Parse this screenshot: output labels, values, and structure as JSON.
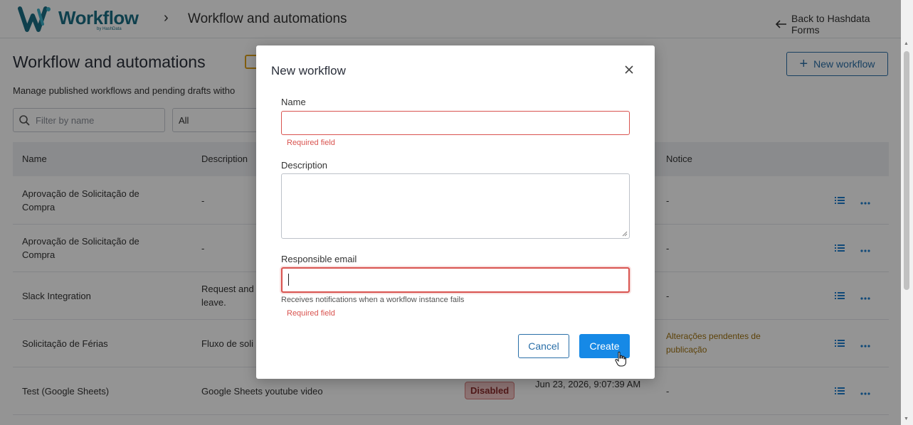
{
  "topbar": {
    "logo_text": "Workflow",
    "logo_sub": "by HashData",
    "breadcrumb_title": "Workflow and automations",
    "back_link": "Back to Hashdata Forms"
  },
  "page": {
    "title": "Workflow and automations",
    "subtitle": "Manage published workflows and pending drafts witho",
    "new_workflow": "New workflow",
    "filter_placeholder": "Filter by name",
    "status_filter": "All"
  },
  "table": {
    "headers": {
      "name": "Name",
      "description": "Description",
      "notice": "Notice"
    },
    "rows": [
      {
        "name": "Aprovação de Solicitação de Compra",
        "description": "-",
        "notice": "-"
      },
      {
        "name": "Aprovação de Solicitação de Compra",
        "description": "-",
        "notice": "-"
      },
      {
        "name": "Slack Integration",
        "description": "Request and leave.",
        "notice": "-"
      },
      {
        "name": "Solicitação de Férias",
        "description": "Fluxo de soli",
        "notice": "Alterações pendentes de publicação"
      },
      {
        "name": "Test (Google Sheets)",
        "description": "Google Sheets youtube video",
        "status": "Disabled",
        "date": "Jun 23, 2026, 9:07:39 AM",
        "notice": "-"
      }
    ]
  },
  "modal": {
    "title": "New workflow",
    "name_label": "Name",
    "name_value": "",
    "name_error": "Required field",
    "description_label": "Description",
    "description_value": "",
    "email_label": "Responsible email",
    "email_value": "",
    "email_hint": "Receives notifications when a workflow instance fails",
    "email_error": "Required field",
    "cancel_label": "Cancel",
    "create_label": "Create"
  },
  "colors": {
    "brand": "#1b6f86",
    "primary": "#1689e6",
    "outline": "#2a6fa8",
    "error": "#d9534f",
    "pending": "#a0720f"
  }
}
